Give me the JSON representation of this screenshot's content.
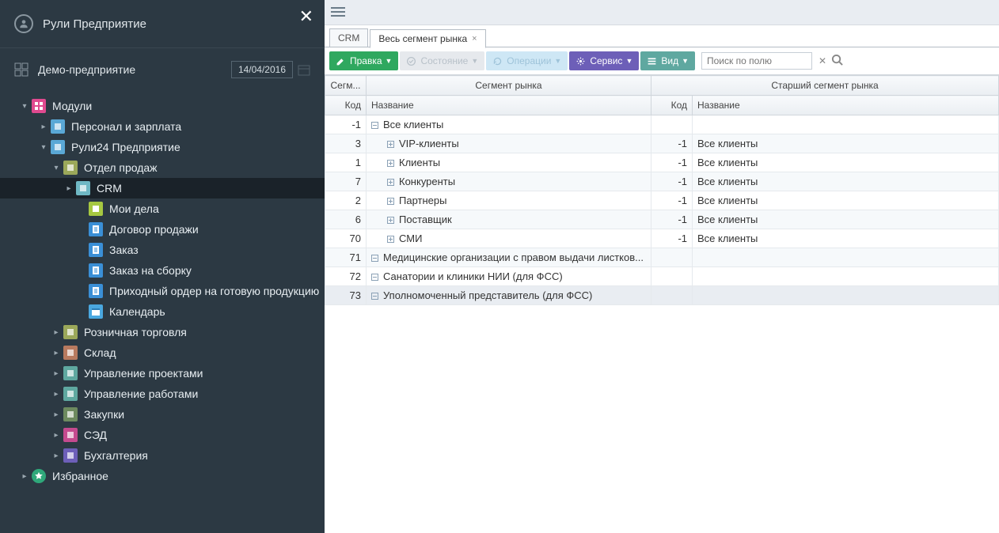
{
  "app": {
    "title": "Рули Предприятие"
  },
  "company": {
    "name": "Демо-предприятие",
    "date": "14/04/2016"
  },
  "tree": {
    "modules_label": "Модули",
    "favorites_label": "Избранное",
    "items": [
      {
        "label": "Персонал и зарплата",
        "color": "#5aa8d6",
        "indent": 50,
        "expander": "▸",
        "icon": "people"
      },
      {
        "label": "Рули24 Предприятие",
        "color": "#5aa8d6",
        "indent": 50,
        "expander": "▾",
        "icon": "ruli"
      },
      {
        "label": "Отдел продаж",
        "color": "#9ba85a",
        "indent": 66,
        "expander": "▾",
        "icon": "dept"
      },
      {
        "label": "CRM",
        "color": "#6fb8c4",
        "indent": 82,
        "expander": "▸",
        "selected": true,
        "icon": "crm"
      },
      {
        "label": "Мои дела",
        "color": "#a6c841",
        "indent": 98,
        "expander": "",
        "icon": "tasks"
      },
      {
        "label": "Договор продажи",
        "color": "#3a8fd6",
        "indent": 98,
        "expander": "",
        "icon": "doc"
      },
      {
        "label": "Заказ",
        "color": "#3a8fd6",
        "indent": 98,
        "expander": "",
        "icon": "doc"
      },
      {
        "label": "Заказ на сборку",
        "color": "#3a8fd6",
        "indent": 98,
        "expander": "",
        "icon": "doc"
      },
      {
        "label": "Приходный ордер на готовую продукцию",
        "color": "#3a8fd6",
        "indent": 98,
        "expander": "",
        "icon": "doc"
      },
      {
        "label": "Календарь",
        "color": "#4aa8e0",
        "indent": 98,
        "expander": "",
        "icon": "calendar"
      },
      {
        "label": "Розничная торговля",
        "color": "#9ba85a",
        "indent": 66,
        "expander": "▸",
        "icon": "dept"
      },
      {
        "label": "Склад",
        "color": "#b87a5f",
        "indent": 66,
        "expander": "▸",
        "icon": "dept"
      },
      {
        "label": "Управление проектами",
        "color": "#5fa8a0",
        "indent": 66,
        "expander": "▸",
        "icon": "dept"
      },
      {
        "label": "Управление работами",
        "color": "#5fa8a0",
        "indent": 66,
        "expander": "▸",
        "icon": "dept"
      },
      {
        "label": "Закупки",
        "color": "#6d8a5f",
        "indent": 66,
        "expander": "▸",
        "icon": "dept"
      },
      {
        "label": "СЭД",
        "color": "#c44a8f",
        "indent": 66,
        "expander": "▸",
        "icon": "dept"
      },
      {
        "label": "Бухгалтерия",
        "color": "#6d5fb8",
        "indent": 66,
        "expander": "▸",
        "icon": "dept"
      }
    ]
  },
  "tabs": [
    {
      "label": "CRM",
      "closable": false,
      "active": false
    },
    {
      "label": "Весь сегмент рынка",
      "closable": true,
      "active": true
    }
  ],
  "toolbar": {
    "edit": "Правка",
    "state": "Состояние",
    "operations": "Операции",
    "service": "Сервис",
    "view": "Вид",
    "search_placeholder": "Поиск по полю"
  },
  "grid": {
    "group_headers": {
      "seg_short": "Сегм...",
      "segment": "Сегмент рынка",
      "parent": "Старший сегмент рынка"
    },
    "headers": {
      "code": "Код",
      "name": "Название",
      "pcode": "Код",
      "pname": "Название"
    },
    "rows": [
      {
        "code": "-1",
        "name": "Все клиенты",
        "indent": 1,
        "exp": "minus",
        "pcode": "",
        "pname": ""
      },
      {
        "code": "3",
        "name": "VIP-клиенты",
        "indent": 2,
        "exp": "plus",
        "pcode": "-1",
        "pname": "Все клиенты"
      },
      {
        "code": "1",
        "name": "Клиенты",
        "indent": 2,
        "exp": "plus",
        "pcode": "-1",
        "pname": "Все клиенты"
      },
      {
        "code": "7",
        "name": "Конкуренты",
        "indent": 2,
        "exp": "plus",
        "pcode": "-1",
        "pname": "Все клиенты"
      },
      {
        "code": "2",
        "name": "Партнеры",
        "indent": 2,
        "exp": "plus",
        "pcode": "-1",
        "pname": "Все клиенты"
      },
      {
        "code": "6",
        "name": "Поставщик",
        "indent": 2,
        "exp": "plus",
        "pcode": "-1",
        "pname": "Все клиенты"
      },
      {
        "code": "70",
        "name": "СМИ",
        "indent": 2,
        "exp": "plus",
        "pcode": "-1",
        "pname": "Все клиенты"
      },
      {
        "code": "71",
        "name": "Медицинские организации с правом выдачи листков...",
        "indent": 1,
        "exp": "minus",
        "pcode": "",
        "pname": ""
      },
      {
        "code": "72",
        "name": "Санатории и клиники НИИ (для ФСС)",
        "indent": 1,
        "exp": "minus",
        "pcode": "",
        "pname": ""
      },
      {
        "code": "73",
        "name": "Уполномоченный представитель (для ФСС)",
        "indent": 1,
        "exp": "minus",
        "pcode": "",
        "pname": "",
        "selected": true
      }
    ]
  }
}
